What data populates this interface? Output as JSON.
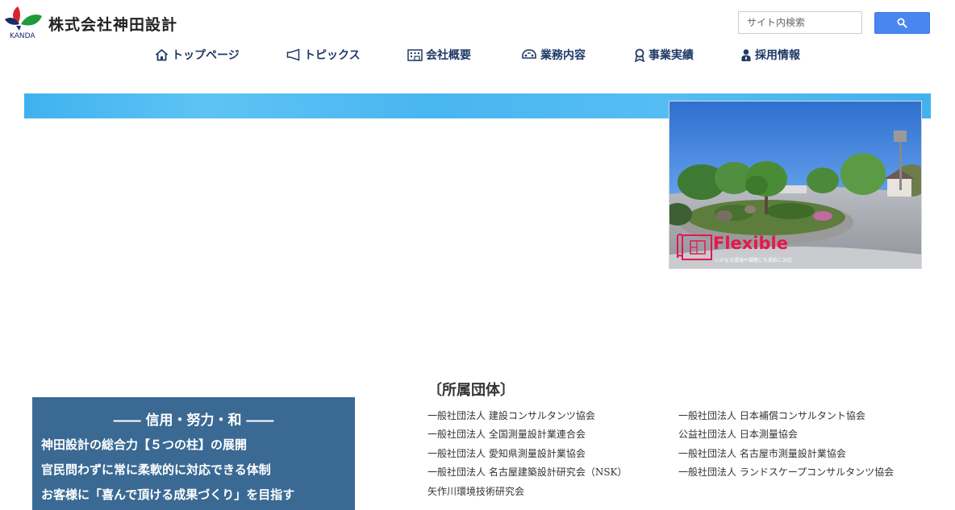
{
  "header": {
    "company_name": "株式会社神田設計",
    "logo_text": "KANDA",
    "search": {
      "placeholder": "サイト内検索"
    }
  },
  "nav": {
    "items": [
      {
        "label": "トップページ",
        "icon": "home-icon"
      },
      {
        "label": "トピックス",
        "icon": "megaphone-icon"
      },
      {
        "label": "会社概要",
        "icon": "building-icon"
      },
      {
        "label": "業務内容",
        "icon": "car-icon"
      },
      {
        "label": "事業実績",
        "icon": "award-icon"
      },
      {
        "label": "採用情報",
        "icon": "person-icon"
      }
    ]
  },
  "hero": {
    "tag_title": "Flexible",
    "tag_subtitle": "いかなる環境や課題にも柔軟に対応",
    "colors": {
      "strip": "#4ab6f0",
      "tag": "#e5174d"
    }
  },
  "motto": {
    "heading": "―― 信用・努力・和 ――",
    "lines": [
      "神田設計の総合力【５つの柱】の展開",
      "官民問わずに常に柔軟的に対応できる体制",
      "お客様に「喜んで頂ける成果づくり」を目指す"
    ],
    "color": "#3a6a94"
  },
  "affiliations": {
    "title": "〔所属団体〕",
    "left": [
      "一般社団法人 建設コンサルタンツ協会",
      "一般社団法人 全国測量設計業連合会",
      "一般社団法人 愛知県測量設計業協会",
      "一般社団法人 名古屋建築設計研究会（NSK）",
      "矢作川環境技術研究会"
    ],
    "right": [
      "一般社団法人 日本補償コンサルタント協会",
      "公益社団法人 日本測量協会",
      "一般社団法人 名古屋市測量設計業協会",
      "一般社団法人 ランドスケープコンサルタンツ協会"
    ]
  }
}
